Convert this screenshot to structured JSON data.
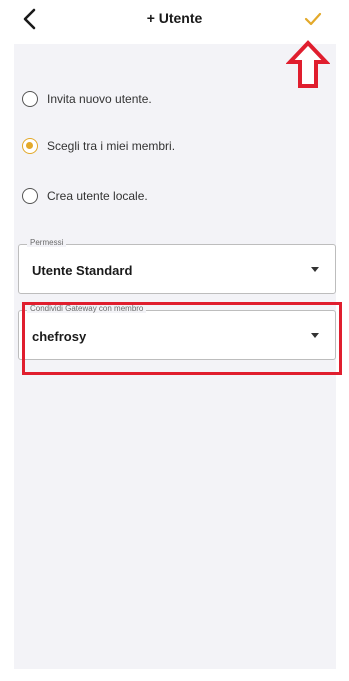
{
  "header": {
    "title": "+ Utente",
    "back_icon": "chevron-left-icon",
    "confirm_icon": "check-icon",
    "accent_color": "#e3a92a"
  },
  "options": [
    {
      "label": "Invita nuovo utente.",
      "selected": false
    },
    {
      "label": "Scegli tra i miei membri.",
      "selected": true
    },
    {
      "label": "Crea utente locale.",
      "selected": false
    }
  ],
  "permissions": {
    "label": "Permessi",
    "value": "Utente Standard"
  },
  "gateway": {
    "label": "Condividi Gateway con membro",
    "value": "chefrosy"
  },
  "annotations": {
    "arrow_icon": "arrow-up-icon",
    "highlight_color": "#e01e2e"
  }
}
